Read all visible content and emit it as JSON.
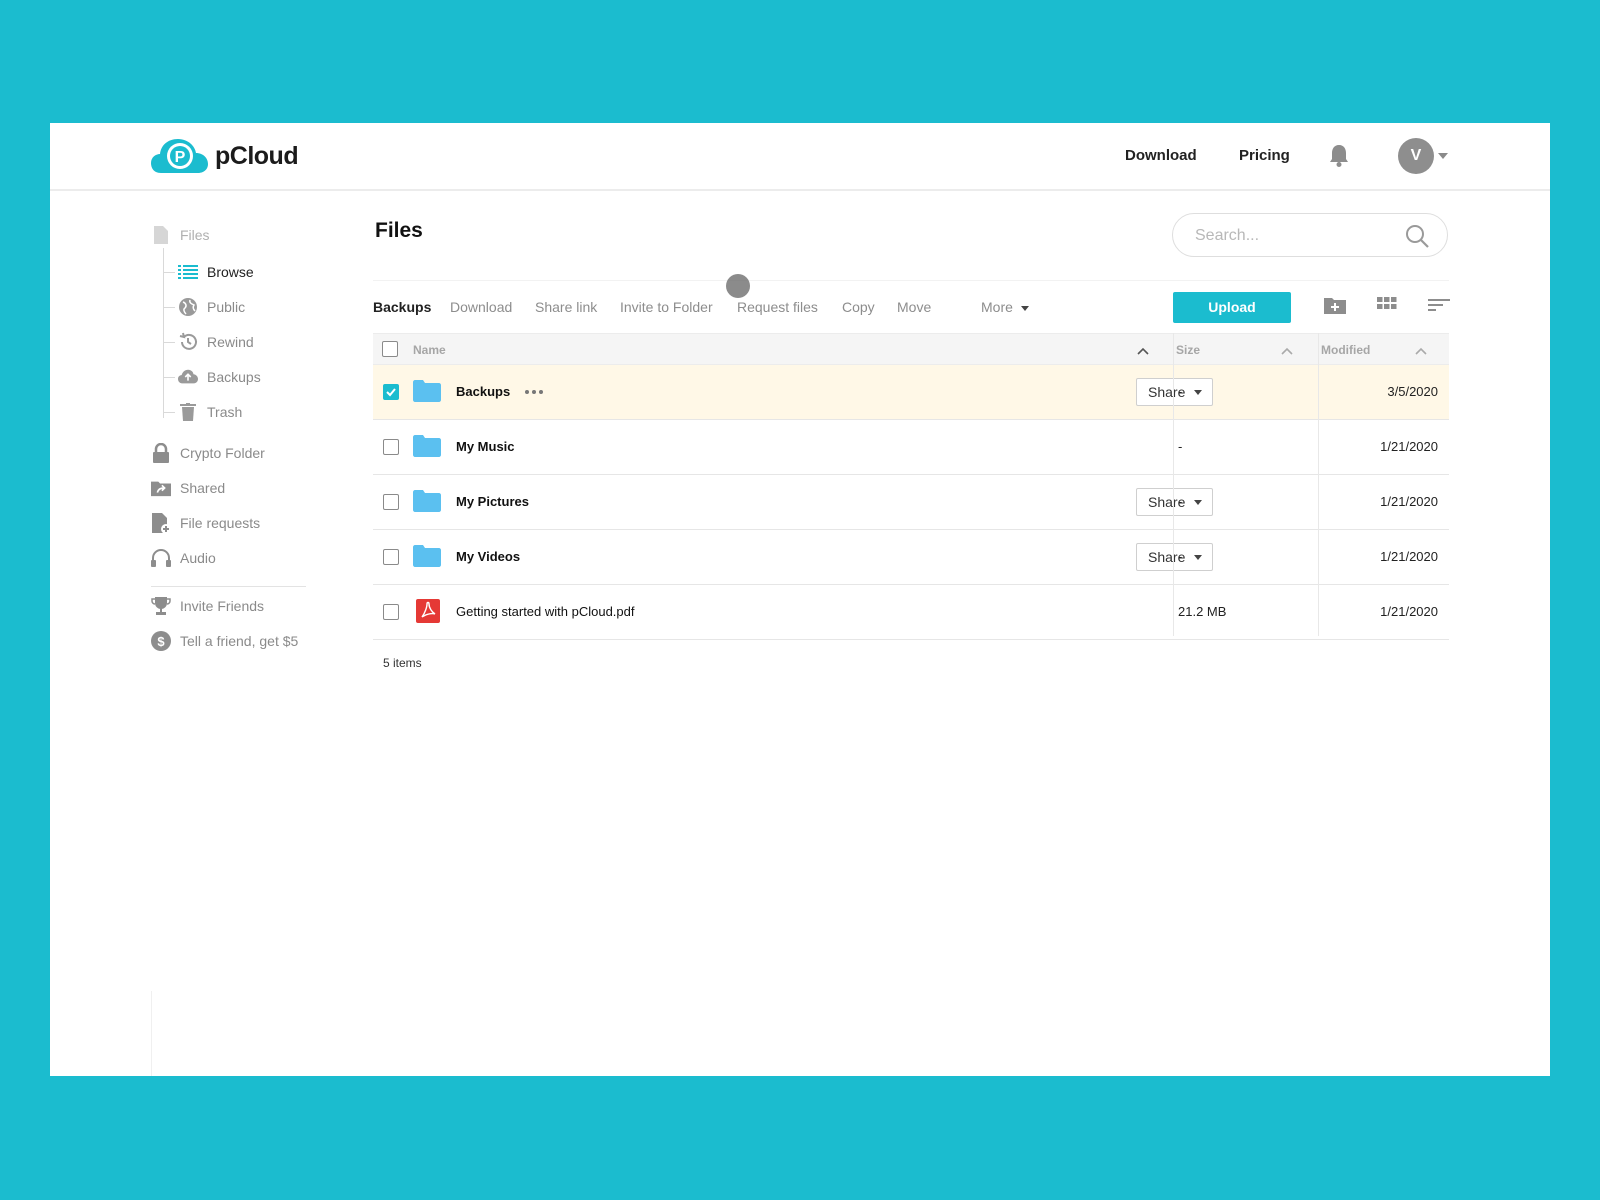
{
  "header": {
    "brand": "pCloud",
    "download_label": "Download",
    "pricing_label": "Pricing",
    "avatar_initial": "V"
  },
  "sidebar": {
    "files_label": "Files",
    "items": [
      {
        "label": "Browse",
        "icon": "list-icon"
      },
      {
        "label": "Public",
        "icon": "globe-icon"
      },
      {
        "label": "Rewind",
        "icon": "history-icon"
      },
      {
        "label": "Backups",
        "icon": "cloud-upload-icon"
      },
      {
        "label": "Trash",
        "icon": "trash-icon"
      }
    ],
    "sections": [
      {
        "label": "Crypto Folder",
        "icon": "lock-icon"
      },
      {
        "label": "Shared",
        "icon": "shared-folder-icon"
      },
      {
        "label": "File requests",
        "icon": "file-request-icon"
      },
      {
        "label": "Audio",
        "icon": "headphones-icon"
      }
    ],
    "extras": [
      {
        "label": "Invite Friends",
        "icon": "trophy-icon"
      },
      {
        "label": "Tell a friend, get $5",
        "icon": "dollar-icon"
      }
    ]
  },
  "main": {
    "title": "Files",
    "search_placeholder": "Search...",
    "toolbar": {
      "selected_name": "Backups",
      "actions": [
        "Download",
        "Share link",
        "Invite to Folder",
        "Request files",
        "Copy",
        "Move"
      ],
      "more_label": "More",
      "upload_label": "Upload"
    },
    "columns": {
      "name": "Name",
      "size": "Size",
      "modified": "Modified"
    },
    "rows": [
      {
        "name": "Backups",
        "type": "folder",
        "size": "-",
        "modified": "3/5/2020",
        "selected": true,
        "share": "Share"
      },
      {
        "name": "My Music",
        "type": "folder",
        "size": "-",
        "modified": "1/21/2020",
        "selected": false,
        "share": ""
      },
      {
        "name": "My Pictures",
        "type": "folder",
        "size": "-",
        "modified": "1/21/2020",
        "selected": false,
        "share": "Share"
      },
      {
        "name": "My Videos",
        "type": "folder",
        "size": "-",
        "modified": "1/21/2020",
        "selected": false,
        "share": "Share"
      },
      {
        "name": "Getting started with pCloud.pdf",
        "type": "pdf",
        "size": "21.2 MB",
        "modified": "1/21/2020",
        "selected": false,
        "share": ""
      }
    ],
    "items_count": "5 items"
  },
  "colors": {
    "accent": "#1bbccf",
    "selected_row": "#fff8e7",
    "folder": "#5bc0f0",
    "pdf": "#e53935"
  }
}
